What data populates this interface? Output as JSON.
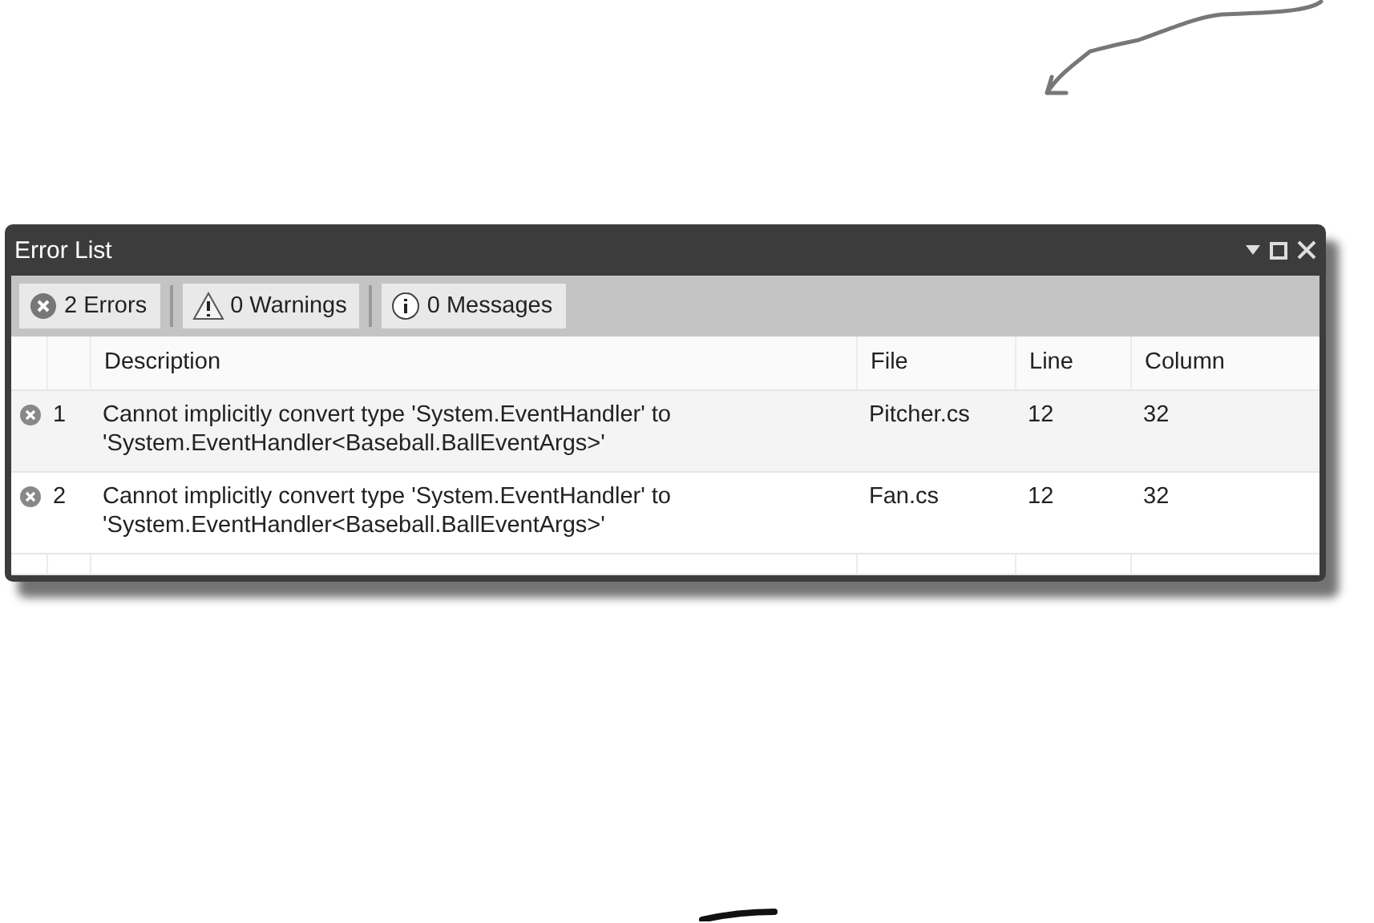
{
  "window": {
    "title": "Error List"
  },
  "filters": [
    {
      "kind": "error",
      "label": "2 Errors"
    },
    {
      "kind": "warning",
      "label": "0 Warnings"
    },
    {
      "kind": "message",
      "label": "0 Messages"
    }
  ],
  "table": {
    "columns": [
      "Description",
      "File",
      "Line",
      "Column"
    ],
    "rows": [
      {
        "number": "1",
        "description": "Cannot implicitly convert type 'System.EventHandler' to 'System.EventHandler<Baseball.BallEventArgs>'",
        "file": "Pitcher.cs",
        "line": "12",
        "column": "32"
      },
      {
        "number": "2",
        "description": "Cannot implicitly convert type 'System.EventHandler' to 'System.EventHandler<Baseball.BallEventArgs>'",
        "file": "Fan.cs",
        "line": "12",
        "column": "32"
      }
    ]
  }
}
